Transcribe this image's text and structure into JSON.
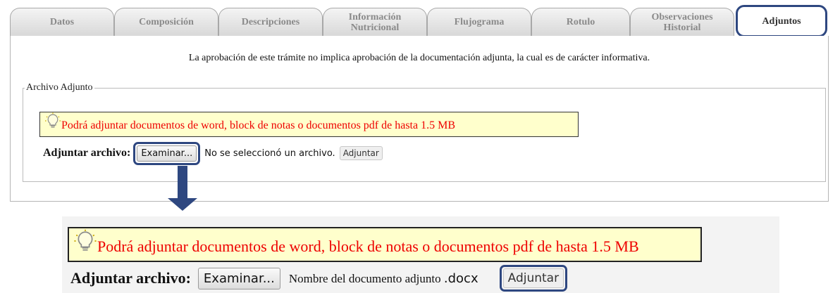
{
  "tabs": [
    {
      "label": "Datos"
    },
    {
      "label": "Composición"
    },
    {
      "label": "Descripciones"
    },
    {
      "label": "Información\nNutricional"
    },
    {
      "label": "Flujograma"
    },
    {
      "label": "Rotulo"
    },
    {
      "label": "Observaciones\nHistorial"
    },
    {
      "label": "Adjuntos"
    }
  ],
  "active_tab": "Adjuntos",
  "notice": "La aprobación de este trámite no implica aprobación de la documentación adjunta, la cual es de carácter informativa.",
  "fieldset": {
    "legend": "Archivo Adjunto",
    "tip": "Podrá adjuntar documentos de word, block de notas o documentos pdf de hasta 1.5 MB",
    "label": "Adjuntar archivo:",
    "browse_button": "Examinar...",
    "no_file_text": "No se seleccionó un archivo.",
    "attach_button": "Adjuntar"
  },
  "zoomed": {
    "tip": "Podrá adjuntar documentos de word, block de notas o documentos pdf de hasta 1.5 MB",
    "label": "Adjuntar archivo:",
    "browse_button": "Examinar...",
    "file_name": "Nombre del documento adjunto",
    "file_ext": ".docx",
    "attach_button": "Adjuntar"
  },
  "colors": {
    "highlight": "#2e4780",
    "tip_text": "#ee0000",
    "tip_bg": "#ffffcc"
  },
  "icons": [
    "lightbulb-icon",
    "down-arrow-icon"
  ]
}
